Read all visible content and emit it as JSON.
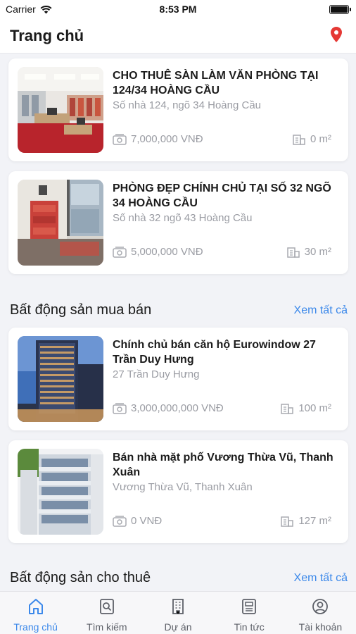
{
  "status": {
    "carrier": "Carrier",
    "time": "8:53 PM"
  },
  "header": {
    "title": "Trang chủ",
    "location_icon": "map-pin-icon",
    "accent": "#e53935"
  },
  "theme": {
    "link_color": "#3b88ea",
    "muted_text": "#9a9ca3"
  },
  "featured": [
    {
      "title": "CHO THUÊ SÀN LÀM VĂN PHÒNG TẠI 124/34 HOÀNG CẦU",
      "address": "Số nhà 124, ngõ 34 Hoàng Cầu",
      "price": "7,000,000 VNĐ",
      "area": "0 m²"
    },
    {
      "title": "PHÒNG ĐẸP CHÍNH CHỦ TẠI  SỐ 32 NGÕ 34 HOÀNG CẦU",
      "address": "Số nhà 32 ngõ 43 Hoàng Cầu",
      "price": "5,000,000 VNĐ",
      "area": "30 m²"
    }
  ],
  "sections": {
    "sale": {
      "title": "Bất động sản mua bán",
      "link": "Xem tất cả"
    },
    "rent": {
      "title": "Bất động sản cho thuê",
      "link": "Xem tất cả"
    }
  },
  "sale_items": [
    {
      "title": "Chính chủ bán căn hộ Eurowindow 27 Trần Duy Hưng",
      "address": "27 Trần Duy Hưng",
      "price": "3,000,000,000 VNĐ",
      "area": "100 m²"
    },
    {
      "title": "Bán nhà mặt phố Vương Thừa Vũ, Thanh Xuân",
      "address": "Vương Thừa Vũ, Thanh Xuân",
      "price": "0 VNĐ",
      "area": "127 m²"
    }
  ],
  "tabs": [
    {
      "label": "Trang chủ",
      "icon": "home-icon",
      "active": true
    },
    {
      "label": "Tìm kiếm",
      "icon": "search-icon",
      "active": false
    },
    {
      "label": "Dự án",
      "icon": "building-icon",
      "active": false
    },
    {
      "label": "Tin tức",
      "icon": "news-icon",
      "active": false
    },
    {
      "label": "Tài khoản",
      "icon": "account-icon",
      "active": false
    }
  ]
}
